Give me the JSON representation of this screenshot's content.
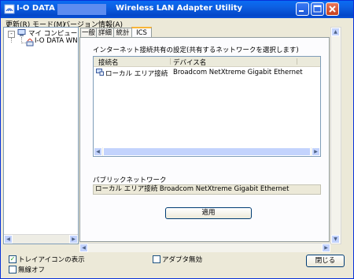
{
  "window": {
    "brand": "I-O DATA",
    "product": "Wireless LAN Adapter Utility",
    "icon": "wifi-adapter-icon",
    "controls": [
      "minimize-icon",
      "maximize-icon",
      "close-icon"
    ]
  },
  "menu": [
    {
      "label": "更新(R)"
    },
    {
      "label": "モード(M)"
    },
    {
      "label": "バージョン情報(A)"
    }
  ],
  "tree": {
    "toggle": "-",
    "root": "マイ コンピュータ",
    "child": "I-O DATA WN-"
  },
  "tabs": [
    {
      "label": "一般",
      "active": false
    },
    {
      "label": "詳細",
      "active": false
    },
    {
      "label": "統計",
      "active": false
    },
    {
      "label": "ICS",
      "active": true
    }
  ],
  "ics": {
    "instruction": "インターネット接続共有の設定(共有するネットワークを選択します)",
    "columns": [
      "接続名",
      "デバイス名"
    ],
    "rows": [
      {
        "name": "ローカル エリア接続",
        "device": "Broadcom NetXtreme Gigabit Ethernet",
        "icon": "network-connection-icon"
      }
    ],
    "public_label": "パブリックネットワーク",
    "public_value": "ローカル エリア接続 Broadcom NetXtreme Gigabit Ethernet",
    "apply_label": "適用"
  },
  "footer": {
    "tray_icon_label": "トレイアイコンの表示",
    "tray_icon_checked": true,
    "adapter_disable_label": "アダプタ無効",
    "adapter_disable_checked": false,
    "wireless_off_label": "無線オフ",
    "wireless_off_checked": false,
    "close_label": "閉じる"
  },
  "colors": {
    "titlebar": "#0a5ce0",
    "tab_active_accent": "#f9b537",
    "window_bg": "#ece9d8"
  }
}
